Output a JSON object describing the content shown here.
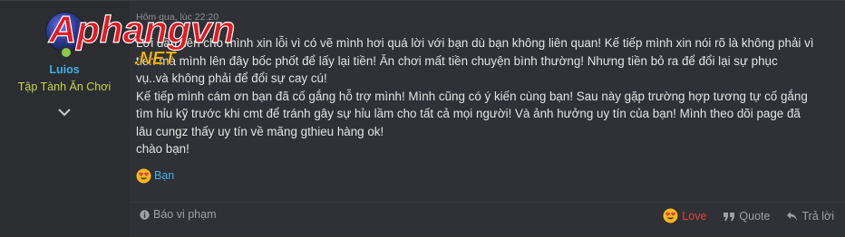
{
  "user": {
    "name": "Luios",
    "title": "Tập Tành Ăn Chơi"
  },
  "post": {
    "timestamp": "Hôm qua, lúc 22:20",
    "lines": [
      "Lời đầu tiên cho mình xin lỗi vì có vẽ mình hơi quá lời với bạn dù bạn không liên quan! Kế tiếp mình xin nói rõ là không phải vì",
      "tiền mà mình lên đây bốc phốt để lấy lại tiền! Ăn chơi mất tiền chuyện bình thường! Nhưng tiền bỏ ra để đổi lại sự phục",
      "vụ..và không phải để đổi sự cay cú!",
      "Kế tiếp mình cám ơn bạn đã cố gắng hỗ trợ mình! Mình cũng có ý kiến cùng bạn! Sau này gặp trường hợp tương tự cố gắng",
      "tìm hỉu kỹ trước khi cmt để tránh gây sự hỉu lầm cho tất cả mọi người! Và ảnh hưởng uy tín của bạn! Mình theo dõi page đã",
      "lâu cungz thấy uy tín về mãng gthieu hàng ok!",
      "chào bạn!"
    ],
    "reaction_label": "Bạn"
  },
  "footer": {
    "report_label": "Báo vi phạm",
    "love_label": "Love",
    "quote_label": "Quote",
    "reply_label": "Trả lời"
  },
  "watermark": {
    "brand": "Aphangvn",
    "suffix": ".NET"
  },
  "colors": {
    "username": "#3db0ea",
    "usertitle": "#c9d54a",
    "love": "#e0433c",
    "background": "#2f3136"
  }
}
